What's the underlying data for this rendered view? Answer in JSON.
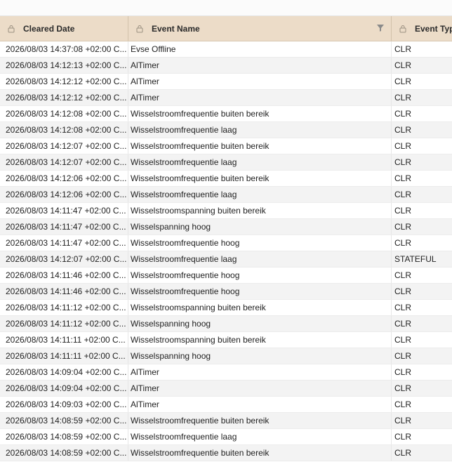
{
  "columns": [
    {
      "label": "Cleared Date",
      "icon": "lock-icon"
    },
    {
      "label": "Event Name",
      "icon": "lock-icon",
      "filter_icon": "filter-icon"
    },
    {
      "label": "Event Type",
      "icon": "lock-icon"
    }
  ],
  "rows": [
    [
      "2026/08/03 14:37:08 +02:00 C...",
      "Evse Offline",
      "CLR"
    ],
    [
      "2026/08/03 14:12:13 +02:00 C...",
      "AlTimer",
      "CLR"
    ],
    [
      "2026/08/03 14:12:12 +02:00 C...",
      "AlTimer",
      "CLR"
    ],
    [
      "2026/08/03 14:12:12 +02:00 C...",
      "AlTimer",
      "CLR"
    ],
    [
      "2026/08/03 14:12:08 +02:00 C...",
      "Wisselstroomfrequentie buiten bereik",
      "CLR"
    ],
    [
      "2026/08/03 14:12:08 +02:00 C...",
      "Wisselstroomfrequentie laag",
      "CLR"
    ],
    [
      "2026/08/03 14:12:07 +02:00 C...",
      "Wisselstroomfrequentie buiten bereik",
      "CLR"
    ],
    [
      "2026/08/03 14:12:07 +02:00 C...",
      "Wisselstroomfrequentie laag",
      "CLR"
    ],
    [
      "2026/08/03 14:12:06 +02:00 C...",
      "Wisselstroomfrequentie buiten bereik",
      "CLR"
    ],
    [
      "2026/08/03 14:12:06 +02:00 C...",
      "Wisselstroomfrequentie laag",
      "CLR"
    ],
    [
      "2026/08/03 14:11:47 +02:00 C...",
      "Wisselstroomspanning buiten bereik",
      "CLR"
    ],
    [
      "2026/08/03 14:11:47 +02:00 C...",
      "Wisselspanning hoog",
      "CLR"
    ],
    [
      "2026/08/03 14:11:47 +02:00 C...",
      "Wisselstroomfrequentie hoog",
      "CLR"
    ],
    [
      "2026/08/03 14:12:07 +02:00 C...",
      "Wisselstroomfrequentie laag",
      "STATEFUL"
    ],
    [
      "2026/08/03 14:11:46 +02:00 C...",
      "Wisselstroomfrequentie hoog",
      "CLR"
    ],
    [
      "2026/08/03 14:11:46 +02:00 C...",
      "Wisselstroomfrequentie hoog",
      "CLR"
    ],
    [
      "2026/08/03 14:11:12 +02:00 C...",
      "Wisselstroomspanning buiten bereik",
      "CLR"
    ],
    [
      "2026/08/03 14:11:12 +02:00 C...",
      "Wisselspanning hoog",
      "CLR"
    ],
    [
      "2026/08/03 14:11:11 +02:00 C...",
      "Wisselstroomspanning buiten bereik",
      "CLR"
    ],
    [
      "2026/08/03 14:11:11 +02:00 C...",
      "Wisselspanning hoog",
      "CLR"
    ],
    [
      "2026/08/03 14:09:04 +02:00 C...",
      "AlTimer",
      "CLR"
    ],
    [
      "2026/08/03 14:09:04 +02:00 C...",
      "AlTimer",
      "CLR"
    ],
    [
      "2026/08/03 14:09:03 +02:00 C...",
      "AlTimer",
      "CLR"
    ],
    [
      "2026/08/03 14:08:59 +02:00 C...",
      "Wisselstroomfrequentie buiten bereik",
      "CLR"
    ],
    [
      "2026/08/03 14:08:59 +02:00 C...",
      "Wisselstroomfrequentie laag",
      "CLR"
    ],
    [
      "2026/08/03 14:08:59 +02:00 C...",
      "Wisselstroomfrequentie buiten bereik",
      "CLR"
    ]
  ],
  "colors": {
    "header_bg": "#ecdcc8",
    "row_alt": "#f3f3f3"
  }
}
